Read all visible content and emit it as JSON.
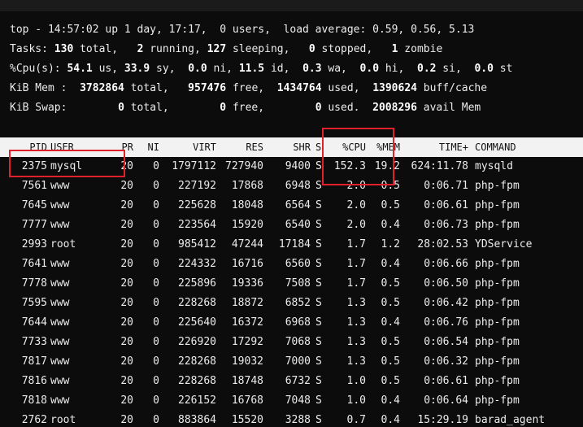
{
  "summary": {
    "line1": "top - 14:57:02 up 1 day, 17:17,  0 users,  load average: 0.59, 0.56, 5.13",
    "tasks": {
      "prefix": "Tasks: ",
      "total": "130",
      "total_label": " total,   ",
      "running": "2",
      "running_label": " running, ",
      "sleeping": "127",
      "sleeping_label": " sleeping,   ",
      "stopped": "0",
      "stopped_label": " stopped,   ",
      "zombie": "1",
      "zombie_label": " zombie"
    },
    "cpu": {
      "prefix": "%Cpu(s): ",
      "us": "54.1",
      "us_label": " us, ",
      "sy": "33.9",
      "sy_label": " sy,  ",
      "ni": "0.0",
      "ni_label": " ni, ",
      "id": "11.5",
      "id_label": " id,  ",
      "wa": "0.3",
      "wa_label": " wa,  ",
      "hi": "0.0",
      "hi_label": " hi,  ",
      "si": "0.2",
      "si_label": " si,  ",
      "st": "0.0",
      "st_label": " st"
    },
    "mem": {
      "prefix": "KiB Mem :  ",
      "total": "3782864",
      "total_label": " total,   ",
      "free": "957476",
      "free_label": " free,  ",
      "used": "1434764",
      "used_label": " used,  ",
      "buff": "1390624",
      "buff_label": " buff/cache"
    },
    "swap": {
      "prefix": "KiB Swap:        ",
      "total": "0",
      "total_label": " total,        ",
      "free": "0",
      "free_label": " free,        ",
      "used": "0",
      "used_label": " used.  ",
      "avail": "2008296",
      "avail_label": " avail Mem"
    }
  },
  "columns": {
    "pid": "PID",
    "user": "USER",
    "pr": "PR",
    "ni": "NI",
    "virt": "VIRT",
    "res": "RES",
    "shr": "SHR",
    "s": "S",
    "cpu": "%CPU",
    "mem": "%MEM",
    "time": "TIME+",
    "cmd": "COMMAND"
  },
  "processes": [
    {
      "pid": "2375",
      "user": "mysql",
      "pr": "20",
      "ni": "0",
      "virt": "1797112",
      "res": "727940",
      "shr": "9400",
      "s": "S",
      "cpu": "152.3",
      "mem": "19.2",
      "time": "624:11.78",
      "cmd": "mysqld"
    },
    {
      "pid": "7561",
      "user": "www",
      "pr": "20",
      "ni": "0",
      "virt": "227192",
      "res": "17868",
      "shr": "6948",
      "s": "S",
      "cpu": "2.0",
      "mem": "0.5",
      "time": "0:06.71",
      "cmd": "php-fpm"
    },
    {
      "pid": "7645",
      "user": "www",
      "pr": "20",
      "ni": "0",
      "virt": "225628",
      "res": "18048",
      "shr": "6564",
      "s": "S",
      "cpu": "2.0",
      "mem": "0.5",
      "time": "0:06.61",
      "cmd": "php-fpm"
    },
    {
      "pid": "7777",
      "user": "www",
      "pr": "20",
      "ni": "0",
      "virt": "223564",
      "res": "15920",
      "shr": "6540",
      "s": "S",
      "cpu": "2.0",
      "mem": "0.4",
      "time": "0:06.73",
      "cmd": "php-fpm"
    },
    {
      "pid": "2993",
      "user": "root",
      "pr": "20",
      "ni": "0",
      "virt": "985412",
      "res": "47244",
      "shr": "17184",
      "s": "S",
      "cpu": "1.7",
      "mem": "1.2",
      "time": "28:02.53",
      "cmd": "YDService"
    },
    {
      "pid": "7641",
      "user": "www",
      "pr": "20",
      "ni": "0",
      "virt": "224332",
      "res": "16716",
      "shr": "6560",
      "s": "S",
      "cpu": "1.7",
      "mem": "0.4",
      "time": "0:06.66",
      "cmd": "php-fpm"
    },
    {
      "pid": "7778",
      "user": "www",
      "pr": "20",
      "ni": "0",
      "virt": "225896",
      "res": "19336",
      "shr": "7508",
      "s": "S",
      "cpu": "1.7",
      "mem": "0.5",
      "time": "0:06.50",
      "cmd": "php-fpm"
    },
    {
      "pid": "7595",
      "user": "www",
      "pr": "20",
      "ni": "0",
      "virt": "228268",
      "res": "18872",
      "shr": "6852",
      "s": "S",
      "cpu": "1.3",
      "mem": "0.5",
      "time": "0:06.42",
      "cmd": "php-fpm"
    },
    {
      "pid": "7644",
      "user": "www",
      "pr": "20",
      "ni": "0",
      "virt": "225640",
      "res": "16372",
      "shr": "6968",
      "s": "S",
      "cpu": "1.3",
      "mem": "0.4",
      "time": "0:06.76",
      "cmd": "php-fpm"
    },
    {
      "pid": "7733",
      "user": "www",
      "pr": "20",
      "ni": "0",
      "virt": "226920",
      "res": "17292",
      "shr": "7068",
      "s": "S",
      "cpu": "1.3",
      "mem": "0.5",
      "time": "0:06.54",
      "cmd": "php-fpm"
    },
    {
      "pid": "7817",
      "user": "www",
      "pr": "20",
      "ni": "0",
      "virt": "228268",
      "res": "19032",
      "shr": "7000",
      "s": "S",
      "cpu": "1.3",
      "mem": "0.5",
      "time": "0:06.32",
      "cmd": "php-fpm"
    },
    {
      "pid": "7816",
      "user": "www",
      "pr": "20",
      "ni": "0",
      "virt": "228268",
      "res": "18748",
      "shr": "6732",
      "s": "S",
      "cpu": "1.0",
      "mem": "0.5",
      "time": "0:06.61",
      "cmd": "php-fpm"
    },
    {
      "pid": "7818",
      "user": "www",
      "pr": "20",
      "ni": "0",
      "virt": "226152",
      "res": "16768",
      "shr": "7048",
      "s": "S",
      "cpu": "1.0",
      "mem": "0.4",
      "time": "0:06.64",
      "cmd": "php-fpm"
    },
    {
      "pid": "2762",
      "user": "root",
      "pr": "20",
      "ni": "0",
      "virt": "883864",
      "res": "15520",
      "shr": "3288",
      "s": "S",
      "cpu": "0.7",
      "mem": "0.4",
      "time": "15:29.19",
      "cmd": "barad_agent"
    }
  ],
  "colors": {
    "background": "#0c0c0c",
    "header_background": "#f2f2f2",
    "highlight_border": "#e0202a"
  }
}
